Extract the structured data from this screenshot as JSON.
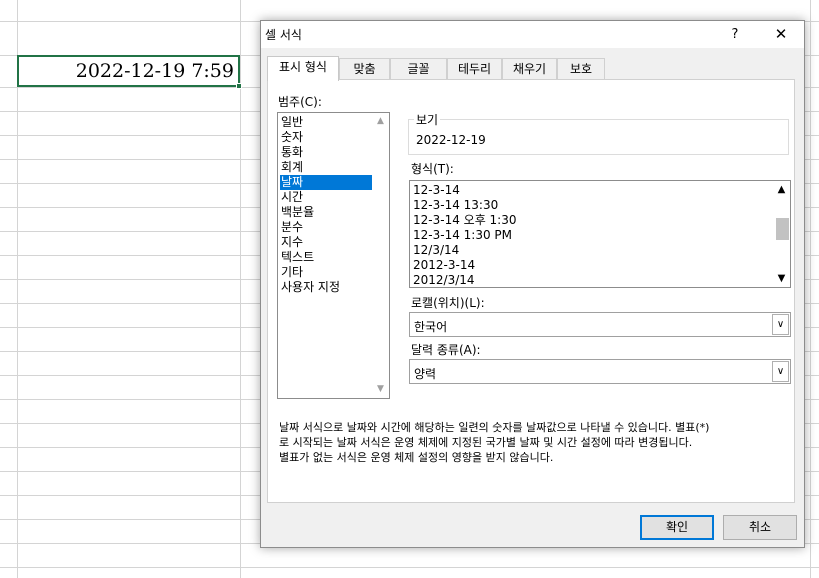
{
  "sheet": {
    "cell_value": "2022-12-19  7:59"
  },
  "dialog": {
    "title": "셀 서식",
    "help_label": "?",
    "close_label": "✕",
    "tabs": [
      {
        "label": "표시 형식",
        "active": true
      },
      {
        "label": "맞춤",
        "active": false
      },
      {
        "label": "글꼴",
        "active": false
      },
      {
        "label": "테두리",
        "active": false
      },
      {
        "label": "채우기",
        "active": false
      },
      {
        "label": "보호",
        "active": false
      }
    ],
    "category_label": "범주(C):",
    "categories": [
      "일반",
      "숫자",
      "통화",
      "회계",
      "날짜",
      "시간",
      "백분율",
      "분수",
      "지수",
      "텍스트",
      "기타",
      "사용자 지정"
    ],
    "selected_category": "날짜",
    "preview_label": "보기",
    "preview_value": "2022-12-19",
    "format_label": "형식(T):",
    "formats": [
      "12-3-14",
      "12-3-14 13:30",
      "12-3-14 오후 1:30",
      "12-3-14 1:30 PM",
      "12/3/14",
      "2012-3-14",
      "2012/3/14"
    ],
    "locale_label": "로캘(위치)(L):",
    "locale_value": "한국어",
    "calendar_label": "달력 종류(A):",
    "calendar_value": "양력",
    "description_lines": [
      "날짜 서식으로 날짜와 시간에 해당하는 일련의 숫자를 날짜값으로 나타낼 수 있습니다. 별표(*)",
      "로 시작되는 날짜 서식은 운영 체제에 지정된 국가별 날짜 및 시간 설정에 따라 변경됩니다.",
      "별표가 없는 서식은 운영 체제 설정의 영향을 받지 않습니다."
    ],
    "ok_label": "확인",
    "cancel_label": "취소"
  },
  "colors": {
    "accent": "#0078d7",
    "excel_green": "#217346"
  }
}
